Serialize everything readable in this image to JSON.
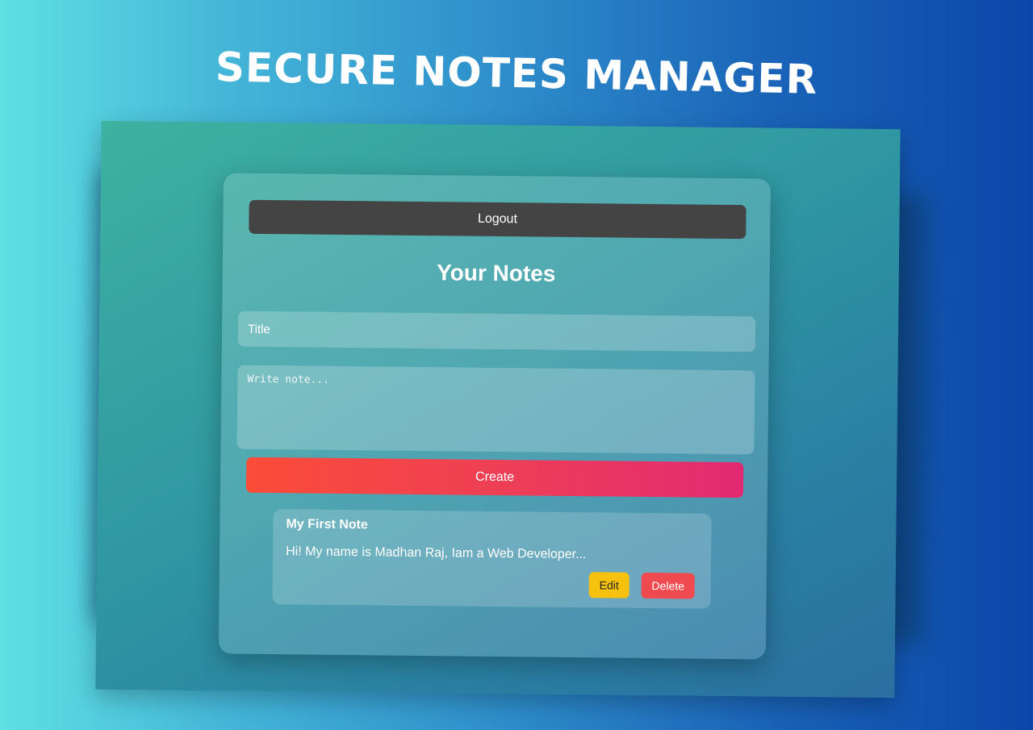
{
  "banner": {
    "title": "SECURE NOTES MANAGER"
  },
  "app": {
    "logout_label": "Logout",
    "heading": "Your Notes",
    "title_placeholder": "Title",
    "note_placeholder": "Write note...",
    "create_label": "Create"
  },
  "notes": [
    {
      "title": "My First Note",
      "body": "Hi! My name is Madhan Raj, Iam a Web Developer...",
      "edit_label": "Edit",
      "delete_label": "Delete"
    }
  ],
  "colors": {
    "logout_button": "#444444",
    "create_gradient_start": "#fb4c38",
    "create_gradient_end": "#e22a72",
    "edit_button": "#f7c20f",
    "delete_button": "#ee4a4f",
    "text": "#ffffff"
  }
}
